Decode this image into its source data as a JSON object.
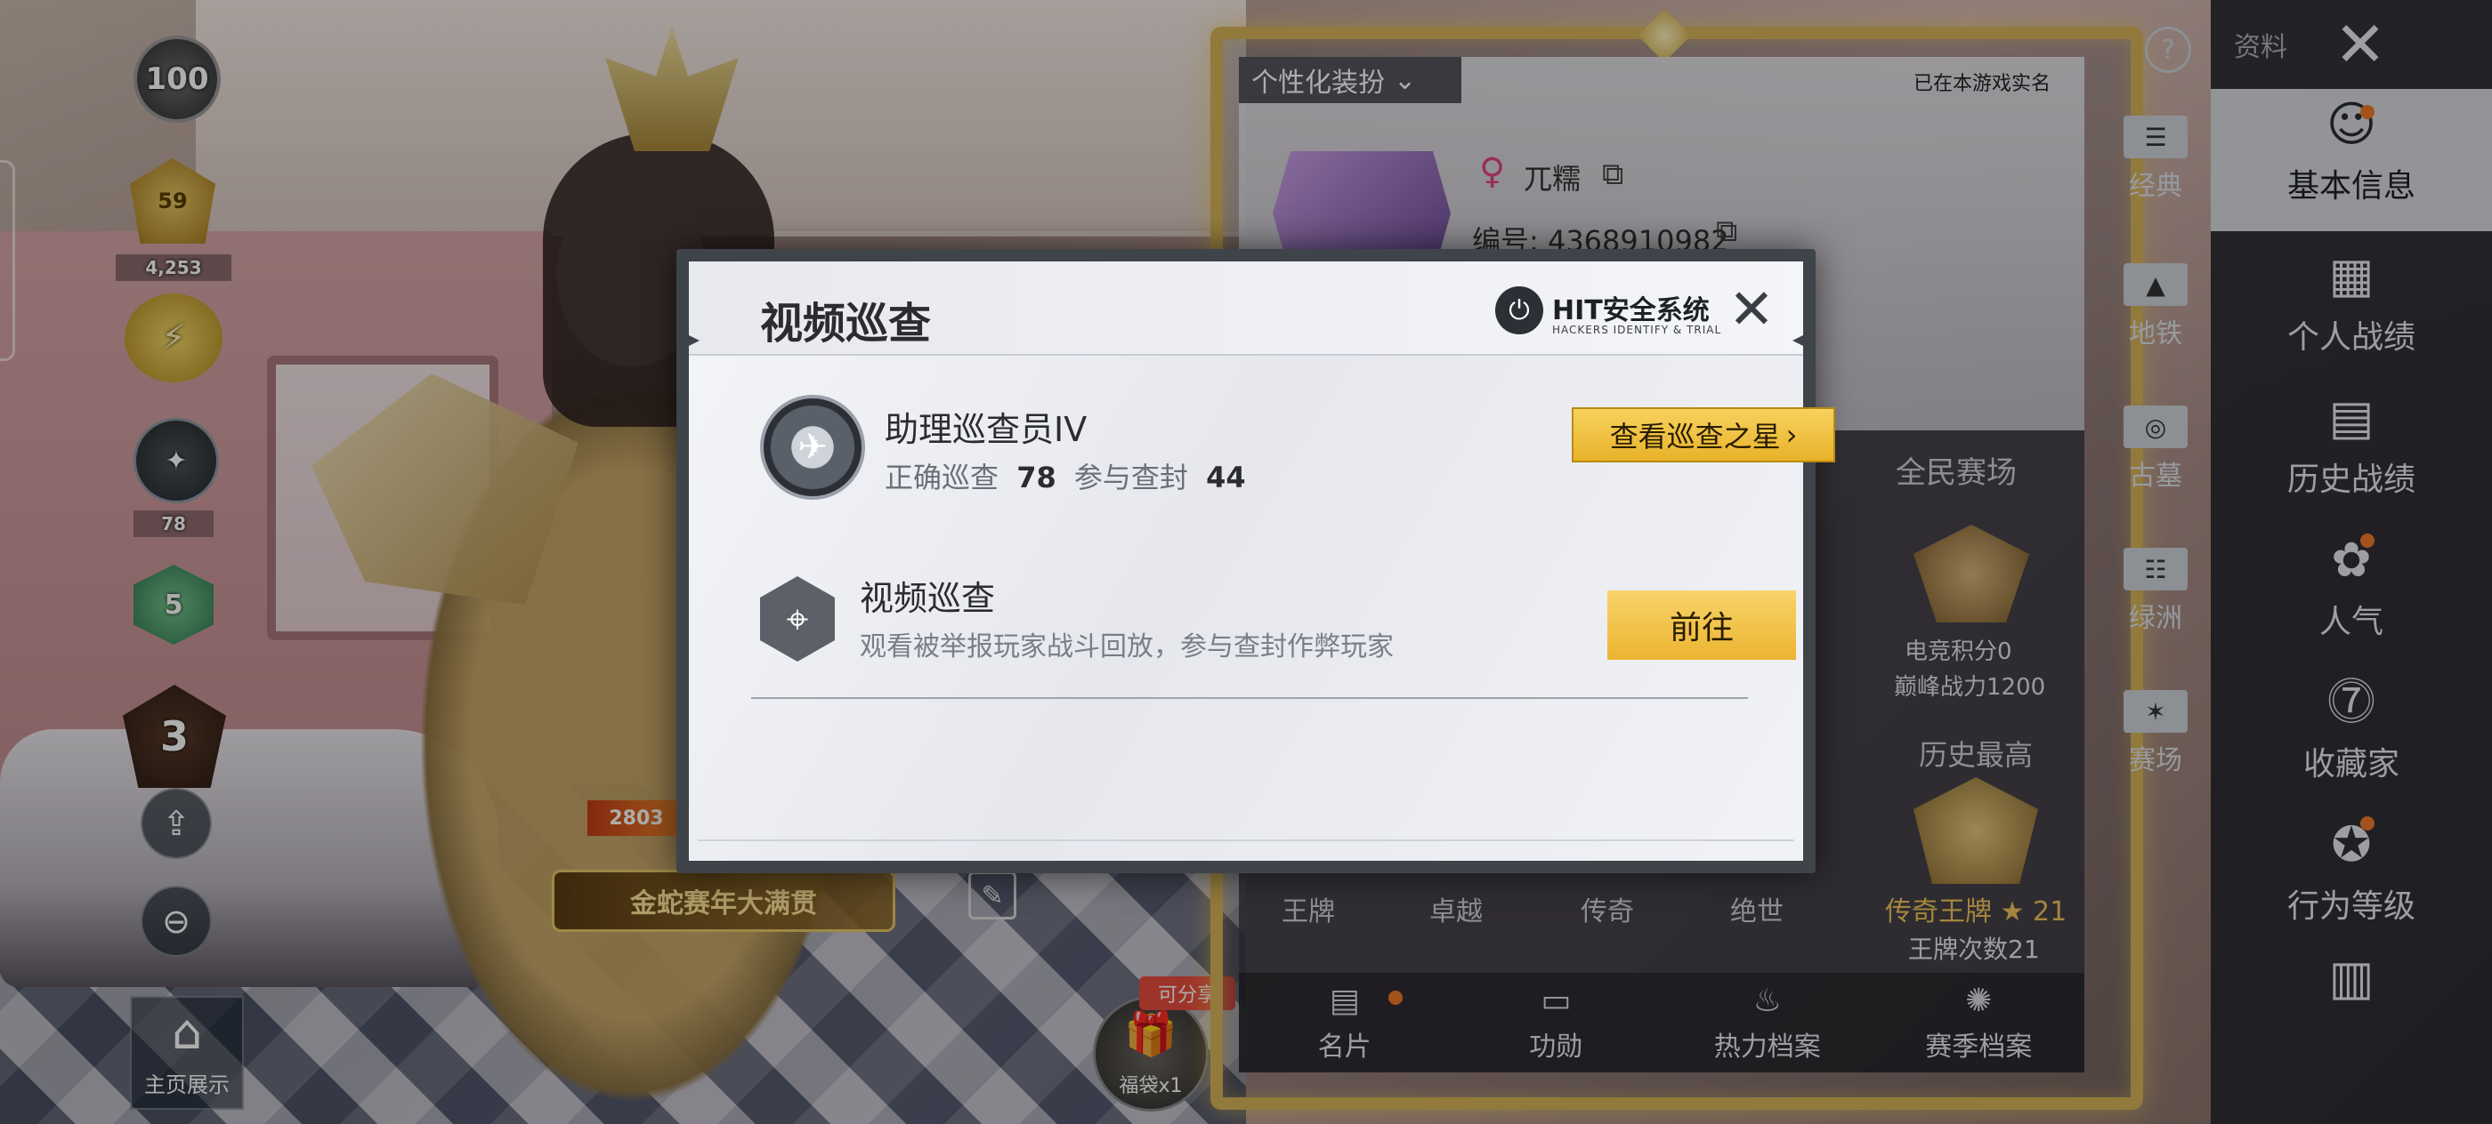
{
  "hud_left": {
    "tier_badge": "100",
    "level_badge": "59",
    "level_score": "4,253",
    "gun_score": "78",
    "green_badge": "5",
    "season_badge": "3",
    "home_display_label": "主页展示"
  },
  "middle": {
    "power_tag": "2803",
    "event_banner": "金蛇赛年大满贯",
    "lucky_bag_label": "福袋x1",
    "shareable_tag": "可分享"
  },
  "profile": {
    "personalize_label": "个性化装扮",
    "realname_note": "已在本游戏实名",
    "player_name": "兀糯",
    "player_id": "编号: 4368910982",
    "all_people_title": "全民赛场",
    "esports_score": "电竞积分0",
    "peak_power": "巅峰战力1200",
    "history_title": "历史最高",
    "history_rank": "传奇王牌",
    "history_rank_stars": "21",
    "ace_count": "王牌次数21",
    "tiers": [
      "王牌",
      "卓越",
      "传奇",
      "绝世"
    ],
    "tabs": [
      {
        "label": "名片",
        "icon": "card-icon"
      },
      {
        "label": "功勋",
        "icon": "medal-icon"
      },
      {
        "label": "热力档案",
        "icon": "flame-icon"
      },
      {
        "label": "赛季档案",
        "icon": "season-icon"
      }
    ]
  },
  "modes": [
    {
      "label": "经典",
      "icon": "classic-mode-icon"
    },
    {
      "label": "地铁",
      "icon": "metro-mode-icon"
    },
    {
      "label": "古墓",
      "icon": "tomb-mode-icon"
    },
    {
      "label": "绿洲",
      "icon": "oasis-mode-icon"
    },
    {
      "label": "赛场",
      "icon": "arena-mode-icon"
    }
  ],
  "sidebar": {
    "title": "资料",
    "items": [
      {
        "label": "基本信息",
        "icon": "basic-info-icon"
      },
      {
        "label": "个人战绩",
        "icon": "personal-record-icon"
      },
      {
        "label": "历史战绩",
        "icon": "history-record-icon"
      },
      {
        "label": "人气",
        "icon": "popularity-icon"
      },
      {
        "label": "收藏家",
        "icon": "collector-icon"
      },
      {
        "label": "行为等级",
        "icon": "behavior-level-icon"
      }
    ]
  },
  "dialog": {
    "title": "视频巡查",
    "brand": "HIT安全系统",
    "brand_sub": "HACKERS IDENTIFY & TRIAL",
    "inspector_rank": "助理巡查员IV",
    "correct_label": "正确巡查",
    "correct_value": "78",
    "ban_label": "参与查封",
    "ban_value": "44",
    "star_button": "查看巡查之星",
    "patrol_title": "视频巡查",
    "patrol_desc": "观看被举报玩家战斗回放，参与查封作弊玩家",
    "go_button": "前往"
  },
  "colors": {
    "accent_gold": "#ecb431",
    "frame_gold": "#d8b45a",
    "notification_dot": "#f07a2a"
  }
}
